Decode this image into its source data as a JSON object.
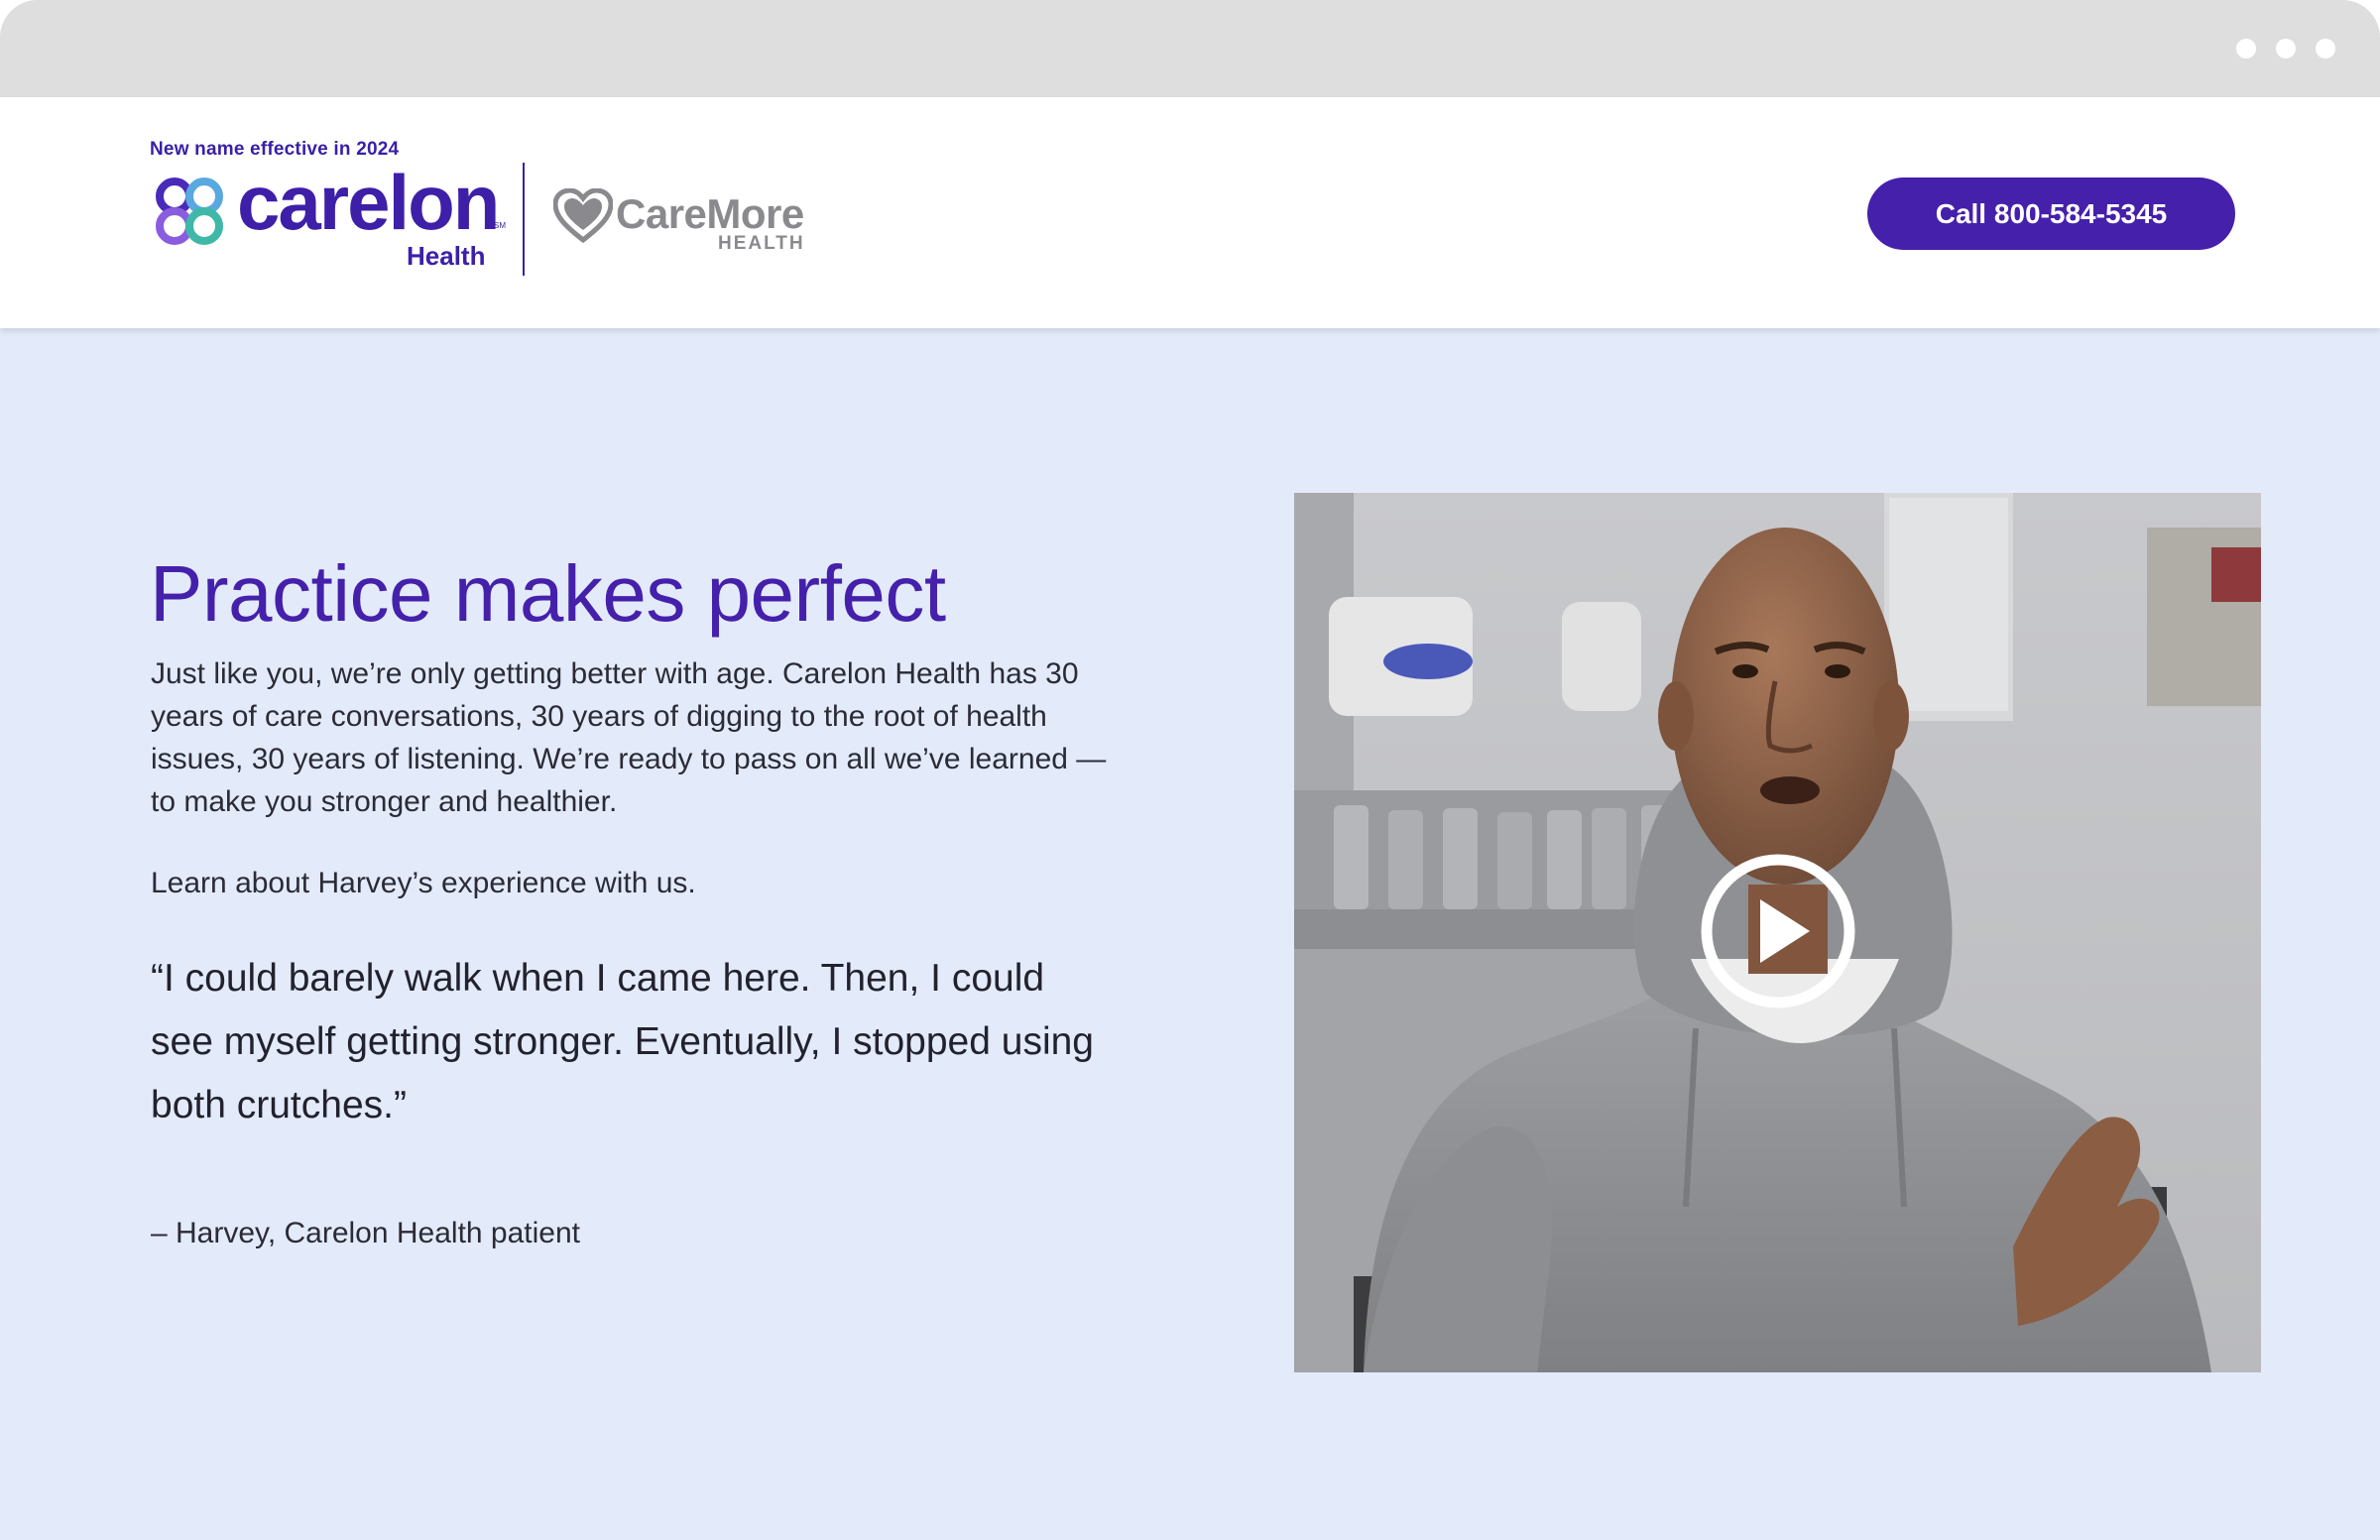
{
  "header": {
    "notice": "New name effective in 2024",
    "carelon_logo": {
      "word": "carelon",
      "sub": "Health",
      "tm": "SM"
    },
    "caremore_logo": {
      "word": "CareMore",
      "sub": "HEALTH"
    },
    "call_button_label": "Call 800-584-5345"
  },
  "hero": {
    "headline": "Practice makes perfect",
    "body": "Just like you, we’re only getting better with age. Carelon Health has 30 years of care conversations, 30 years of digging to the root of health issues, 30 years of listening. We’re ready to pass on all we’ve learned — to make you stronger and healthier.",
    "learn": "Learn about Harvey’s experience with us.",
    "quote": "“I could barely walk when I came here. Then, I could see myself getting stronger. Eventually, I stopped using both crutches.”",
    "attribution": "– Harvey, Carelon Health patient"
  },
  "video": {
    "icon": "play-icon"
  },
  "colors": {
    "brand_purple": "#4520ab",
    "hero_background": "#e3ebfb",
    "caremore_gray": "#8a8a8e",
    "browser_chrome": "#dededf"
  }
}
